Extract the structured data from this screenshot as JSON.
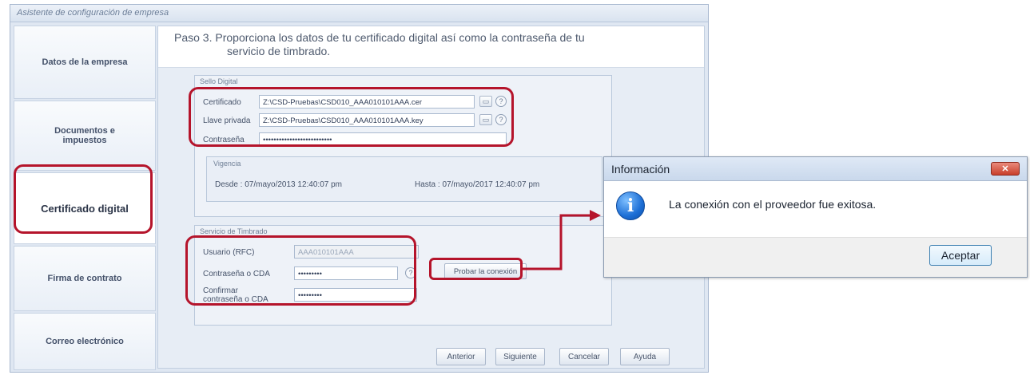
{
  "wizard": {
    "title": "Asistente de configuración de empresa",
    "sidebar": {
      "items": [
        {
          "label": "Datos de la empresa"
        },
        {
          "label_line1": "Documentos e",
          "label_line2": "impuestos"
        },
        {
          "label": "Certificado digital"
        },
        {
          "label": "Firma de contrato"
        },
        {
          "label": "Correo electrónico"
        }
      ]
    },
    "step": {
      "line1": "Paso 3. Proporciona los datos de tu certificado digital así como la contraseña de tu",
      "line2": "servicio de timbrado."
    },
    "sello": {
      "group_label": "Sello Digital",
      "cert_label": "Certificado",
      "cert_value": "Z:\\CSD-Pruebas\\CSD010_AAA010101AAA.cer",
      "key_label": "Llave privada",
      "key_value": "Z:\\CSD-Pruebas\\CSD010_AAA010101AAA.key",
      "pwd_label": "Contraseña",
      "pwd_value": "••••••••••••••••••••••••••"
    },
    "vigencia": {
      "group_label": "Vigencia",
      "desde": "Desde : 07/mayo/2013 12:40:07 pm",
      "hasta": "Hasta : 07/mayo/2017 12:40:07 pm"
    },
    "timbrado": {
      "group_label": "Servicio de Timbrado",
      "user_label": "Usuario (RFC)",
      "user_value": "AAA010101AAA",
      "pwd_label": "Contraseña o CDA",
      "pwd_value": "•••••••••",
      "confirm_label_1": "Confirmar",
      "confirm_label_2": "contraseña o CDA",
      "confirm_value": "•••••••••",
      "probar_label": "Probar la conexión"
    },
    "buttons": {
      "anterior": "Anterior",
      "siguiente": "Siguiente",
      "cancelar": "Cancelar",
      "ayuda": "Ayuda"
    }
  },
  "dialog": {
    "title": "Información",
    "message": "La conexión con el proveedor fue exitosa.",
    "ok_label": "Aceptar",
    "close_glyph": "✕",
    "icon": "info-icon"
  },
  "icons": {
    "browse": "browse-icon",
    "help_glyph": "?",
    "browse_glyph": "▭",
    "info_glyph": "i"
  },
  "colors": {
    "highlight": "#b5142b",
    "dialog_button_border": "#3c7fb1",
    "info_icon": "#1d6fd6"
  }
}
